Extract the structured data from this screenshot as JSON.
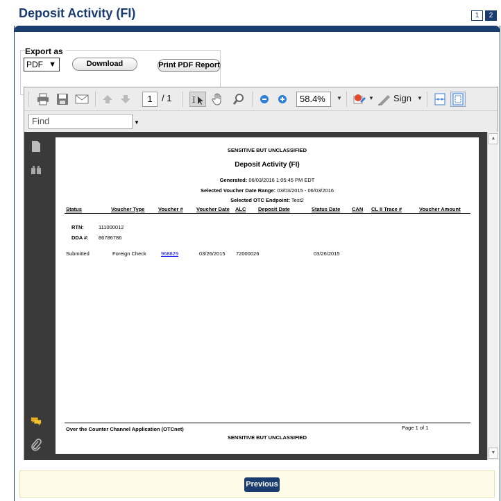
{
  "page": {
    "title": "Deposit Activity (FI)"
  },
  "pager": {
    "page1": "1",
    "page2": "2"
  },
  "export": {
    "label": "Export as",
    "format_value": "PDF",
    "download_label": "Download",
    "print_label": "Print PDF Report"
  },
  "viewer": {
    "page_current": "1",
    "page_total": "/ 1",
    "zoom": "58.4%",
    "sign_label": "Sign",
    "find_placeholder": "Find"
  },
  "report": {
    "classification_top": "SENSITIVE BUT UNCLASSIFIED",
    "title": "Deposit Activity (FI)",
    "generated_label": "Generated:",
    "generated_value": "06/03/2016 1:05:45 PM EDT",
    "range_label": "Selected Voucher Date Range:",
    "range_value": "03/03/2015 - 06/03/2016",
    "endpoint_label": "Selected OTC Endpoint:",
    "endpoint_value": "Test2",
    "columns": [
      "Status",
      "Voucher Type",
      "Voucher #",
      "Voucher Date",
      "ALC",
      "Deposit Date",
      "Status Date",
      "CAN",
      "CL II Trace #",
      "Voucher Amount"
    ],
    "rtn_label": "RTN:",
    "rtn_value": "111000012",
    "dda_label": "DDA #:",
    "dda_value": "86786786",
    "row": {
      "status": "Submitted",
      "voucher_type": "Foreign Check",
      "voucher_no": "968829",
      "voucher_date": "03/26/2015",
      "alc": "72000026",
      "status_date": "03/26/2015"
    },
    "footer_left": "Over the Counter Channel Application (OTCnet)",
    "footer_right": "Page 1 of 1",
    "classification_bottom": "SENSITIVE BUT UNCLASSIFIED"
  },
  "nav": {
    "previous_label": "Previous"
  },
  "colors": {
    "brand": "#1a3c6e",
    "link": "#0000ee",
    "footer_bg": "#fdfbe8"
  }
}
